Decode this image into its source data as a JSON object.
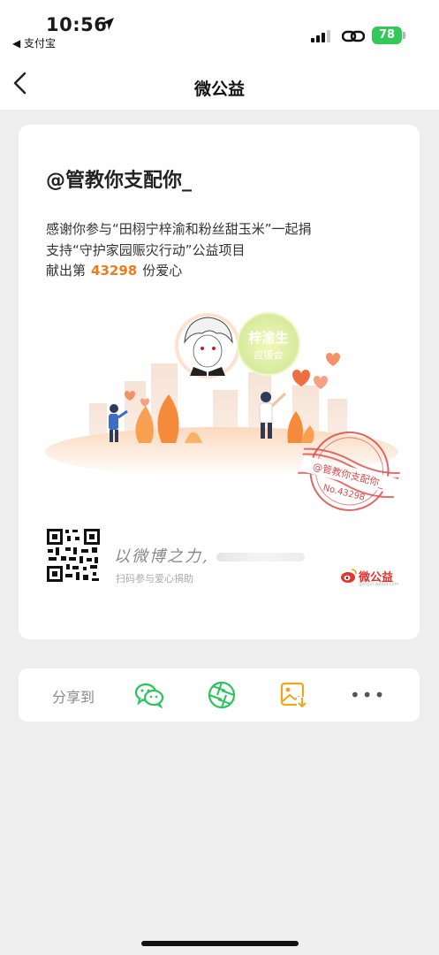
{
  "status_bar": {
    "time": "10:56",
    "back_app": "◀ 支付宝",
    "battery": "78"
  },
  "nav": {
    "title": "微公益"
  },
  "card": {
    "username": "@管教你支配你_",
    "thanks_line1": "感谢你参与“田栩宁梓渝和粉丝甜玉米”一起捐",
    "thanks_line2": "支持“守护家园赈灾行动”公益项目",
    "count_prefix": "献出第",
    "count_number": "43298",
    "count_suffix": "份爱心",
    "badge_text": "梓渝生\n应援会",
    "stamp_name": "@管教你支配你_",
    "stamp_no": "No.43298",
    "signature": "以微博之力,",
    "scan_note": "扫码参与爱心捐助",
    "brand_name": "微公益",
    "brand_url": "gongyi.weibo.com"
  },
  "share": {
    "label": "分享到",
    "items": [
      {
        "icon": "wechat-icon",
        "color": "#2bc35c"
      },
      {
        "icon": "moments-icon",
        "color": "#2bc35c"
      },
      {
        "icon": "save-image-icon",
        "color": "#f0a51e"
      },
      {
        "icon": "more-icon",
        "label": "•••"
      }
    ]
  },
  "colors": {
    "accent_orange": "#f07b1b",
    "brand_red": "#e5322d",
    "green": "#2bc35c"
  }
}
